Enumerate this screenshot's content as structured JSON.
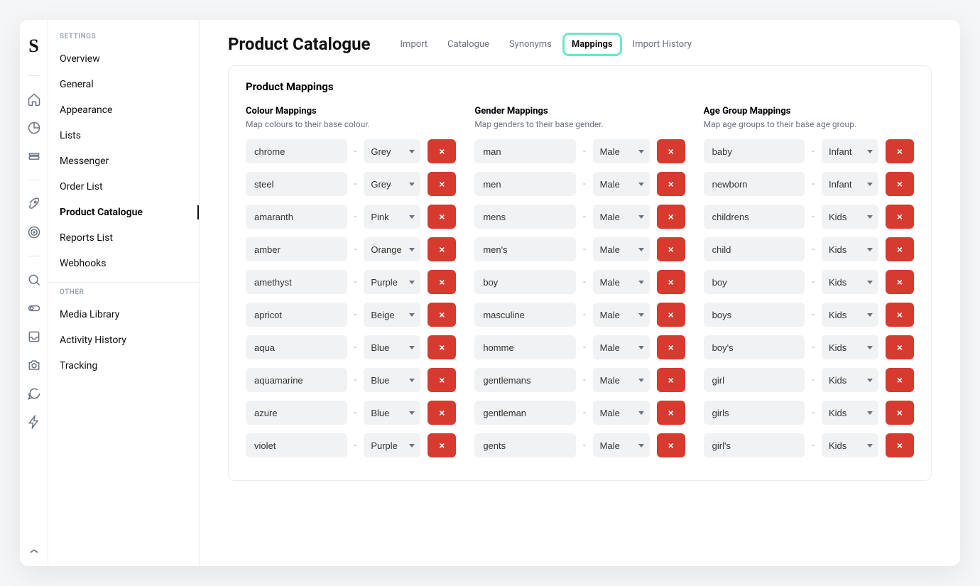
{
  "page_title": "Product Catalogue",
  "tabs": [
    "Import",
    "Catalogue",
    "Synonyms",
    "Mappings",
    "Import History"
  ],
  "active_tab": "Mappings",
  "sidebar": {
    "heading_settings": "SETTINGS",
    "heading_other": "OTHER",
    "settings": [
      "Overview",
      "General",
      "Appearance",
      "Lists",
      "Messenger",
      "Order List",
      "Product Catalogue",
      "Reports List",
      "Webhooks"
    ],
    "other": [
      "Media Library",
      "Activity History",
      "Tracking"
    ],
    "active": "Product Catalogue"
  },
  "panel": {
    "title": "Product Mappings",
    "columns": [
      {
        "title": "Colour Mappings",
        "desc": "Map colours to their base colour.",
        "rows": [
          {
            "value": "chrome",
            "select": "Grey"
          },
          {
            "value": "steel",
            "select": "Grey"
          },
          {
            "value": "amaranth",
            "select": "Pink"
          },
          {
            "value": "amber",
            "select": "Orange"
          },
          {
            "value": "amethyst",
            "select": "Purple"
          },
          {
            "value": "apricot",
            "select": "Beige"
          },
          {
            "value": "aqua",
            "select": "Blue"
          },
          {
            "value": "aquamarine",
            "select": "Blue"
          },
          {
            "value": "azure",
            "select": "Blue"
          },
          {
            "value": "violet",
            "select": "Purple"
          }
        ]
      },
      {
        "title": "Gender Mappings",
        "desc": "Map genders to their base gender.",
        "rows": [
          {
            "value": "man",
            "select": "Male"
          },
          {
            "value": "men",
            "select": "Male"
          },
          {
            "value": "mens",
            "select": "Male"
          },
          {
            "value": "men's",
            "select": "Male"
          },
          {
            "value": "boy",
            "select": "Male"
          },
          {
            "value": "masculine",
            "select": "Male"
          },
          {
            "value": "homme",
            "select": "Male"
          },
          {
            "value": "gentlemans",
            "select": "Male"
          },
          {
            "value": "gentleman",
            "select": "Male"
          },
          {
            "value": "gents",
            "select": "Male"
          }
        ]
      },
      {
        "title": "Age Group Mappings",
        "desc": "Map age groups to their base age group.",
        "rows": [
          {
            "value": "baby",
            "select": "Infant"
          },
          {
            "value": "newborn",
            "select": "Infant"
          },
          {
            "value": "childrens",
            "select": "Kids"
          },
          {
            "value": "child",
            "select": "Kids"
          },
          {
            "value": "boy",
            "select": "Kids"
          },
          {
            "value": "boys",
            "select": "Kids"
          },
          {
            "value": "boy's",
            "select": "Kids"
          },
          {
            "value": "girl",
            "select": "Kids"
          },
          {
            "value": "girls",
            "select": "Kids"
          },
          {
            "value": "girl's",
            "select": "Kids"
          }
        ]
      }
    ]
  }
}
